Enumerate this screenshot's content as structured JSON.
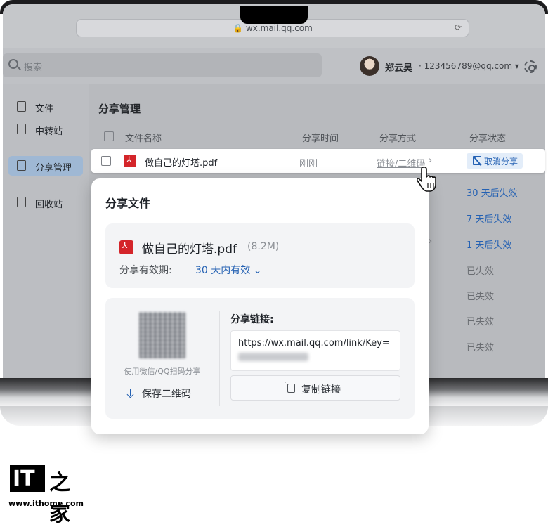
{
  "browser": {
    "url": "wx.mail.qq.com"
  },
  "header": {
    "search_placeholder": "搜索",
    "user_name": "郑云昊",
    "user_email": "· 123456789@qq.com ▾"
  },
  "sidebar": {
    "items": [
      {
        "label": "文件",
        "icon": "file-icon"
      },
      {
        "label": "中转站",
        "icon": "transfer-icon"
      },
      {
        "label": "分享管理",
        "icon": "share-icon",
        "active": true
      },
      {
        "label": "回收站",
        "icon": "trash-icon"
      }
    ]
  },
  "main": {
    "title": "分享管理",
    "columns": [
      "文件名称",
      "分享时间",
      "分享方式",
      "分享状态"
    ],
    "active_row": {
      "name": "做自己的灯塔.pdf",
      "time": "刚刚",
      "method": "链接/二维码",
      "action": "取消分享"
    },
    "statuses": [
      "30 天后失效",
      "7 天后失效",
      "1 天后失效",
      "已失效",
      "已失效",
      "已失效",
      "已失效"
    ]
  },
  "modal": {
    "title": "分享文件",
    "file_name": "做自己的灯塔.pdf",
    "file_size": "(8.2M)",
    "expiry_label": "分享有效期:",
    "expiry_value": "30 天内有效 ⌄",
    "qr_caption": "使用微信/QQ扫码分享",
    "save_qr": "保存二维码",
    "link_label": "分享链接:",
    "link_text": "https://wx.mail.qq.com/link/Key=",
    "copy_button": "复制链接"
  },
  "branding": {
    "logo_it": "IT",
    "logo_hz": "之家",
    "site": "www.ithome.com"
  },
  "colors": {
    "accent": "#2461b3",
    "pdf_red": "#d4252a"
  }
}
